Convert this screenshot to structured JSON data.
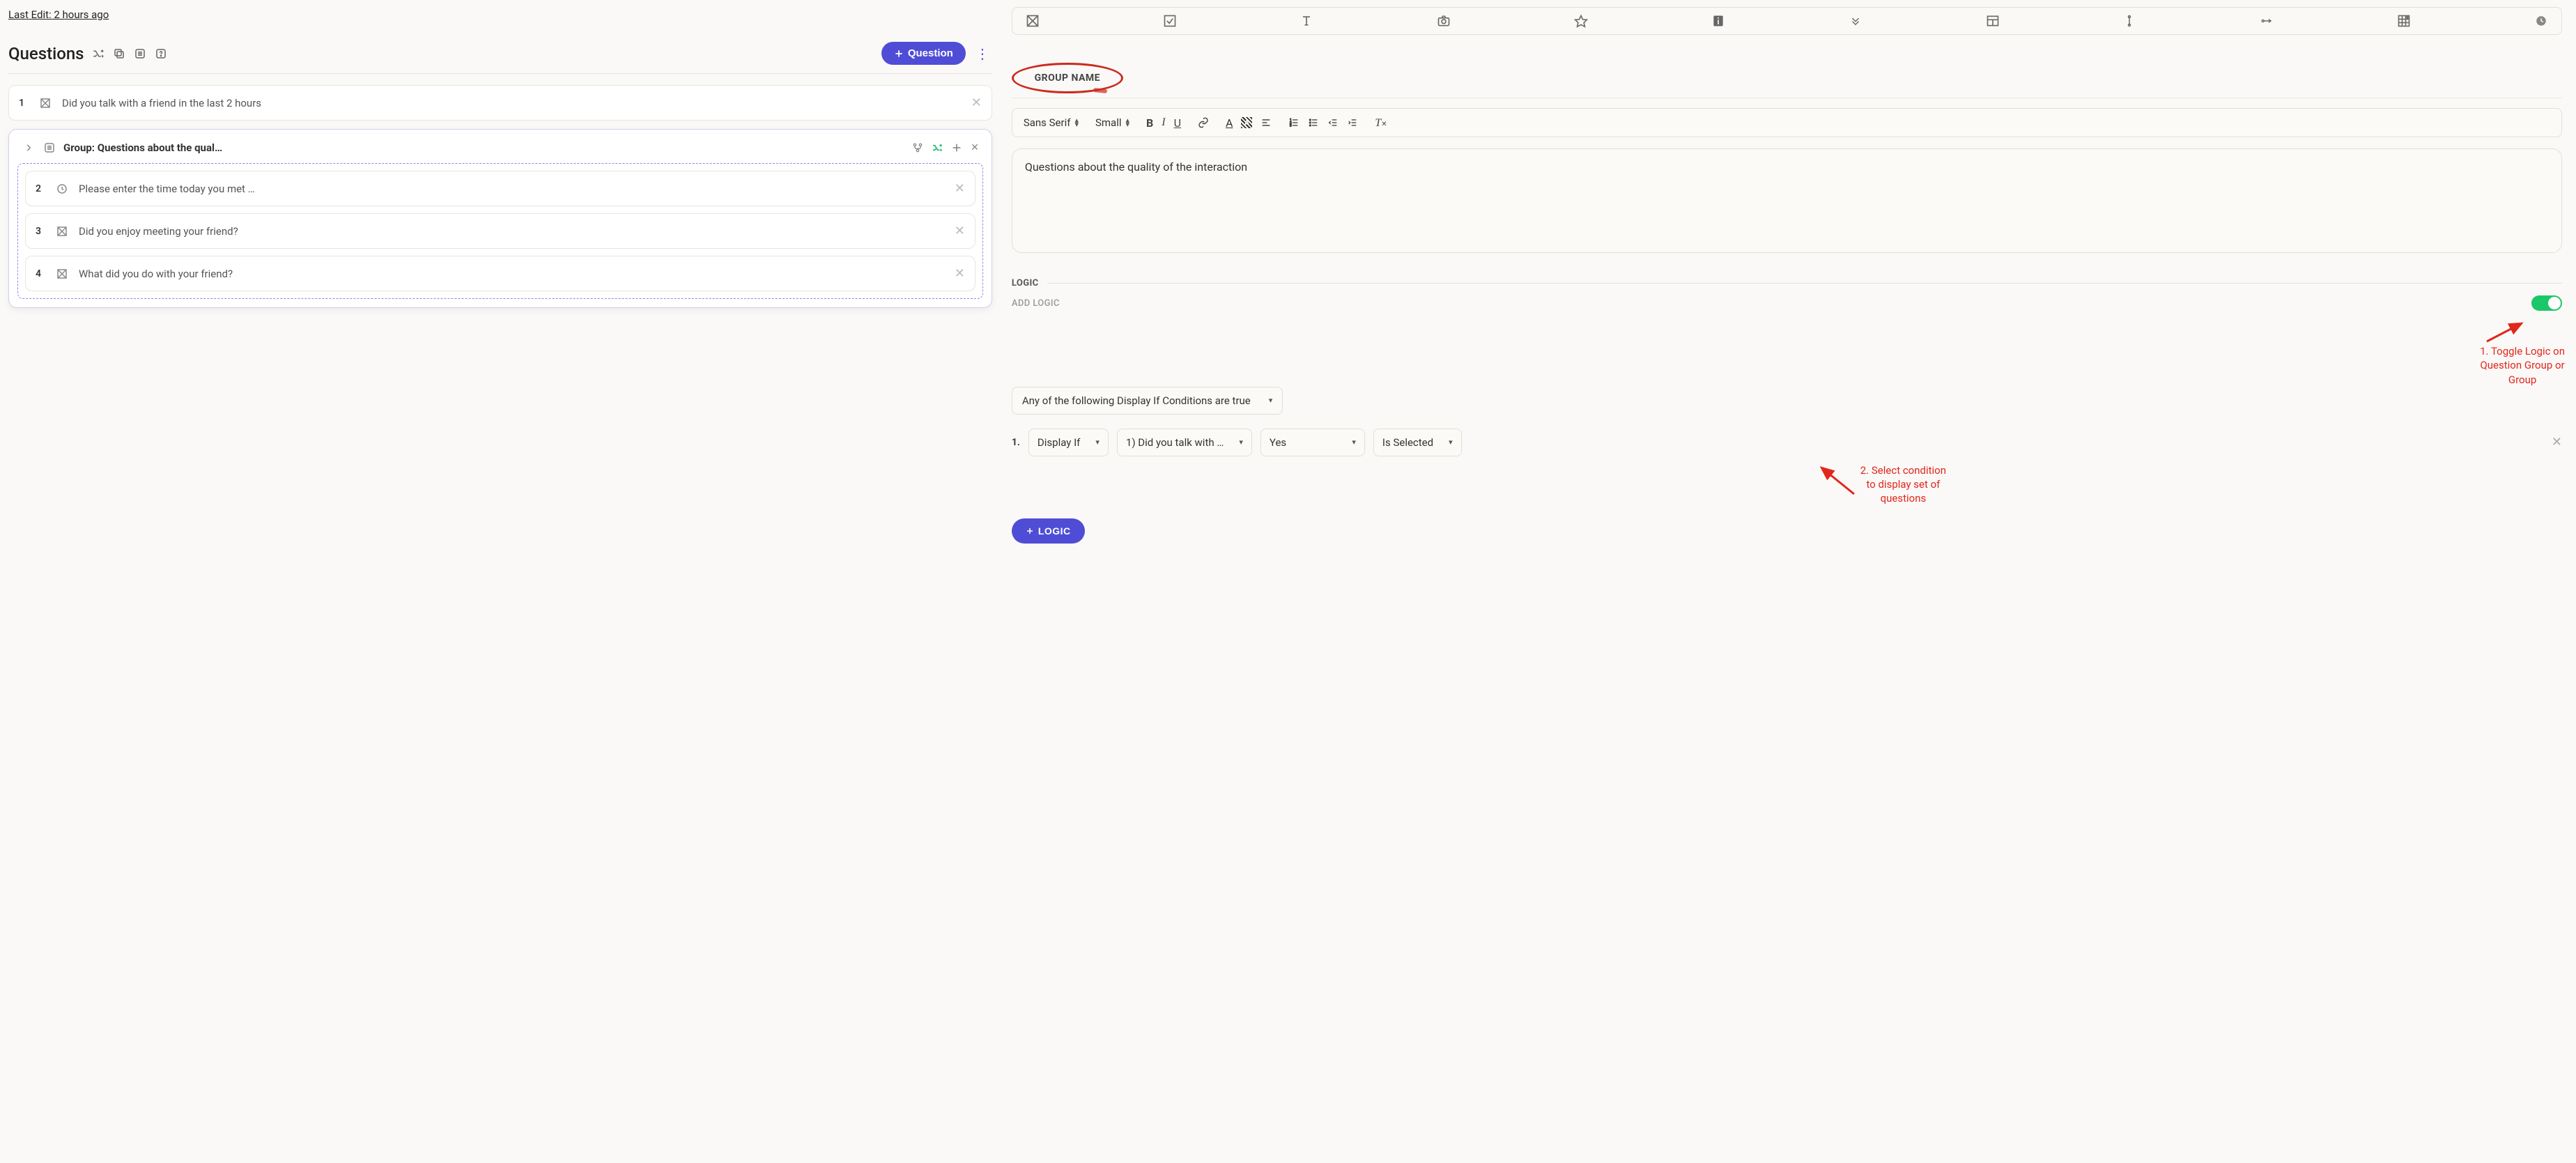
{
  "left": {
    "last_edit": "Last Edit: 2 hours ago",
    "title": "Questions",
    "add_button": "Question",
    "items": {
      "q1": {
        "num": "1",
        "text": "Did you talk with a friend in the last 2 hours"
      },
      "group_title": "Group: Questions about the qual…",
      "q2": {
        "num": "2",
        "text": "Please enter the time today you met …"
      },
      "q3": {
        "num": "3",
        "text": "Did you enjoy meeting your friend?"
      },
      "q4": {
        "num": "4",
        "text": "What did you do with your friend?"
      }
    }
  },
  "right": {
    "group_name_label": "GROUP NAME",
    "font_family": "Sans Serif",
    "font_size": "Small",
    "description": "Questions about the quality of the interaction",
    "logic_label": "LOGIC",
    "add_logic_label": "ADD LOGIC",
    "condition_mode": "Any of the following Display If Conditions are true",
    "cond": {
      "num": "1.",
      "type": "Display If",
      "question": "1) Did you talk with …",
      "value": "Yes",
      "op": "Is Selected"
    },
    "add_logic_btn": "LOGIC"
  },
  "annotations": {
    "a1_l1": "1. Toggle Logic on",
    "a1_l2": "Question Group or",
    "a1_l3": "Group",
    "a2_l1": "2. Select condition",
    "a2_l2": "to display set of",
    "a2_l3": "questions"
  }
}
